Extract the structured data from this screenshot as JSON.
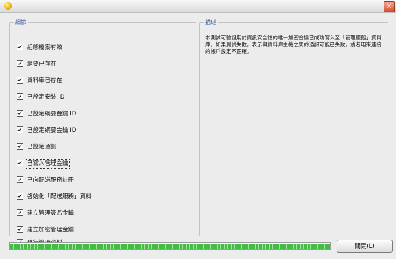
{
  "window": {
    "close_glyph": "✕"
  },
  "steps_group": {
    "legend": "細節",
    "items": [
      {
        "label": "組態檔案有效"
      },
      {
        "label": "綱要已存在"
      },
      {
        "label": "資料庫已存在"
      },
      {
        "label": "已設定安裝 ID"
      },
      {
        "label": "已設定綱要金鑰 ID"
      },
      {
        "label": "已設定綱要金鑰 ID"
      },
      {
        "label": "已設定通訊"
      },
      {
        "label": "已寫入管理金鑰"
      },
      {
        "label": "已向配送服務註冊"
      },
      {
        "label": "啓始化「配送服務」資料"
      },
      {
        "label": "建立管理簽名金鑰"
      },
      {
        "label": "建立加密管理金鑰"
      },
      {
        "label": "發行管理資料"
      }
    ]
  },
  "description_group": {
    "legend": "描述",
    "text": "本測試可驗證用於資訊安全性的唯一加密金鑰已成功寫入至「管理服務」資料庫。如果測試失敗，表示與資料庫主機之間的通訊可能已失敗，或者用來連接的帳戶設定不正確。"
  },
  "progress": {
    "value": 1.0
  },
  "buttons": {
    "close_label": "關閉(L)"
  },
  "colors": {
    "progress": "#45bb45",
    "legend": "#3b5aa6"
  }
}
